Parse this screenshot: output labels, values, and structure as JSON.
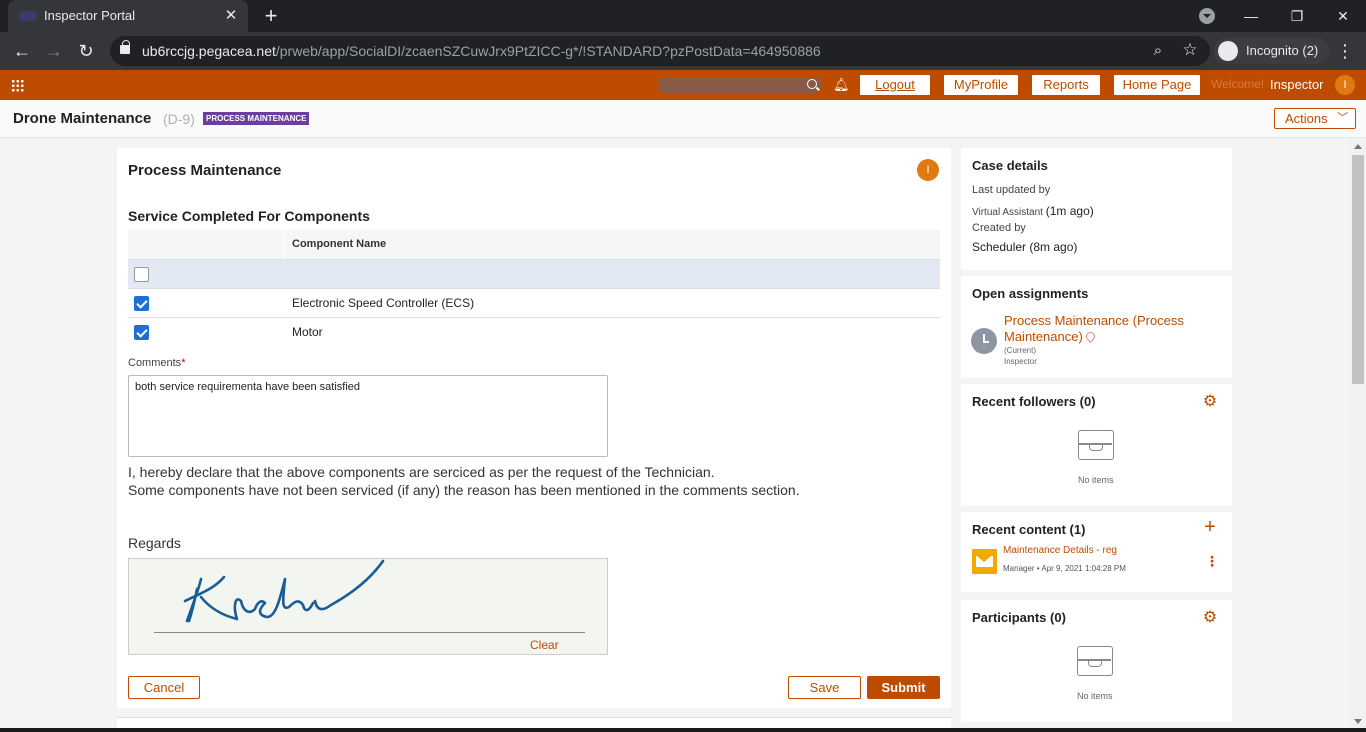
{
  "browser": {
    "tab_title": "Inspector Portal",
    "url_host": "ub6rccjg.pegacea.net",
    "url_path": "/prweb/app/SocialDI/zcaenSZCuwJrx9PtZICC-g*/!STANDARD?pzPostData=464950886",
    "profile_label": "Incognito (2)"
  },
  "header": {
    "nav_buttons": [
      "Logout",
      "MyProfile",
      "Reports",
      "Home Page"
    ],
    "welcome_text": "Welcome!",
    "user_name": "Inspector",
    "user_initial": "I"
  },
  "case": {
    "title": "Drone Maintenance",
    "id": "(D-9)",
    "status_badge": "PROCESS MAINTENANCE",
    "actions_label": "Actions"
  },
  "form": {
    "title": "Process Maintenance",
    "badge_initial": "I",
    "section_title": "Service Completed For Components",
    "table_header": "Component Name",
    "rows": [
      {
        "checked": false,
        "name": ""
      },
      {
        "checked": true,
        "name": "Electronic Speed Controller (ECS)"
      },
      {
        "checked": true,
        "name": "Motor"
      }
    ],
    "comments_label": "Comments",
    "comments_required_mark": "*",
    "comments_value": "both service requirementa have been satisfied",
    "declaration_line1": "I, hereby declare that the above components are serciced as per the request of the Technician.",
    "declaration_line2": "Some components have not been serviced (if any) the reason has been mentioned in the comments section.",
    "regards_label": "Regards",
    "clear_label": "Clear",
    "cancel_label": "Cancel",
    "save_label": "Save",
    "submit_label": "Submit"
  },
  "sidebar": {
    "case_details": {
      "title": "Case details",
      "last_updated_label": "Last updated by",
      "last_updated_by": "Virtual Assistant",
      "last_updated_ago": "(1m ago)",
      "created_label": "Created by",
      "created_by": "Scheduler (8m ago)"
    },
    "open_assignments": {
      "title": "Open assignments",
      "assignment_name": "Process Maintenance (Process Maintenance)",
      "assignment_status": "(Current)",
      "assignment_owner": "Inspector"
    },
    "followers": {
      "title": "Recent followers (0)",
      "empty_text": "No items"
    },
    "recent_content": {
      "title": "Recent content (1)",
      "item_title": "Maintenance Details - reg",
      "item_meta": "Manager • Apr 9, 2021 1:04:28 PM"
    },
    "participants": {
      "title": "Participants (0)",
      "empty_text": "No items"
    }
  },
  "colors": {
    "brand": "#bd4c00",
    "badge_purple": "#6b3fa0",
    "checkbox_blue": "#1f6fd1",
    "avatar_orange": "#e07a10"
  },
  "icons": [
    "apps-grid-icon",
    "search-icon",
    "bell-icon",
    "chevron-down-icon",
    "gear-icon",
    "inbox-icon",
    "clock-icon",
    "location-pin-icon",
    "plus-icon",
    "mail-icon",
    "more-vert-icon"
  ]
}
